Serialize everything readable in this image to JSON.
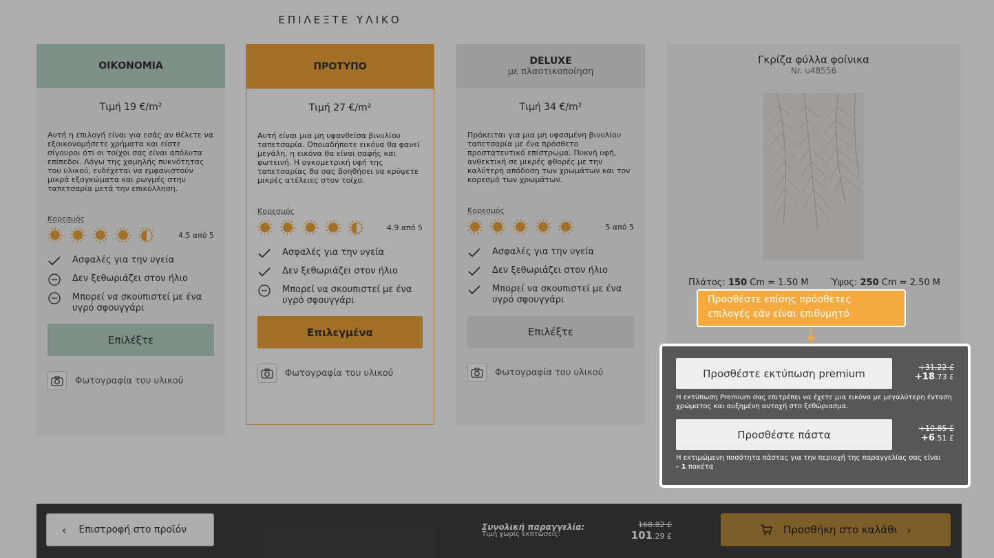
{
  "heading": "ΕΠΙΛΕΞΤΕ ΥΛΙΚΟ",
  "materials": [
    {
      "title": "ΟΙΚΟΝΟΜΙΑ",
      "subtitle": "",
      "price": "Τιμή 19 €/m²",
      "description": "Αυτή η επιλογή είναι για εσάς αν θέλετε να εξοικονομήσετε χρήματα και είστε σίγουροι ότι οι τοίχοι σας είναι απόλυτα επίπεδοι. Λόγω της χαμηλής πυκνότητας του υλικού, ενδέχεται να εμφανιστούν μικρά εξογκώματα και ρωγμές στην ταπετσαρία μετά την επικόλληση.",
      "saturation_label": "Κορεσμός",
      "rating_value": 4.5,
      "rating_text": "4.5 από 5",
      "features": [
        {
          "icon": "check-icon",
          "text": "Ασφαλές για την υγεία"
        },
        {
          "icon": "minus-circle-icon",
          "text": "Δεν ξεθωριάζει στον ήλιο"
        },
        {
          "icon": "minus-circle-icon",
          "text": "Μπορεί να σκουπιστεί με ένα υγρό σφουγγάρι"
        }
      ],
      "button": "Επιλέξτε",
      "photo_label": "Φωτογραφία του υλικού"
    },
    {
      "title": "ΠΡΟΤΥΠΟ",
      "subtitle": "",
      "price": "Τιμή 27 €/m²",
      "description": "Αυτή είναι μια μη υφανθείσα βινυλίου ταπετσαρία. Οποιαδήποτε εικόνα θα φανεί μεγάλη, η εικόνα θα είναι σαφής και φωτεινή. Η ογκομετρική υφή της ταπετσαρίας θα σας βοηθήσει να κρύψετε μικρές ατέλειες στον τοίχο.",
      "saturation_label": "Κορεσμός",
      "rating_value": 4.9,
      "rating_text": "4.9 από 5",
      "features": [
        {
          "icon": "check-icon",
          "text": "Ασφαλές για την υγεία"
        },
        {
          "icon": "check-icon",
          "text": "Δεν ξεθωριάζει στον ήλιο"
        },
        {
          "icon": "minus-circle-icon",
          "text": "Μπορεί να σκουπιστεί με ένα υγρό σφουγγάρι"
        }
      ],
      "button": "Επιλεγμένα",
      "photo_label": "Φωτογραφία του υλικού"
    },
    {
      "title": "DELUXE",
      "subtitle": "με πλαστικοποίηση",
      "price": "Τιμή 34 €/m²",
      "description": "Πρόκειται για μια μη υφασμένη βινυλίου ταπετσαρία με ένα πρόσθετο προστατευτικό επίστρωμα. Πυκνή υφή, ανθεκτική σε μικρές φθορές με την καλύτερη απόδοση των χρωμάτων και τον κορεσμό των χρωμάτων.",
      "saturation_label": "Κορεσμός",
      "rating_value": 5,
      "rating_text": "5 από 5",
      "features": [
        {
          "icon": "check-icon",
          "text": "Ασφαλές για την υγεία"
        },
        {
          "icon": "check-icon",
          "text": "Δεν ξεθωριάζει στον ήλιο"
        },
        {
          "icon": "check-icon",
          "text": "Μπορεί να σκουπιστεί με ένα υγρό σφουγγάρι"
        }
      ],
      "button": "Επιλέξτε",
      "photo_label": "Φωτογραφία του υλικού"
    }
  ],
  "preview": {
    "title": "Γκρίζα φύλλα φοίνικα",
    "number": "Nr. u48556",
    "width_label": "Πλάτος:",
    "width_value": "150",
    "width_unit": "Cm = 1.50 M",
    "height_label": "Ύψος:",
    "height_value": "250",
    "height_unit": "Cm = 2.50 M"
  },
  "tooltip": "Προσθέστε επίσης πρόσθετες επιλογές εάν είναι επιθυμητό",
  "extras": {
    "premium": {
      "button": "Προσθέστε εκτύπωση premium",
      "old_price": "+31.22 £",
      "new_price_main": "+18",
      "new_price_cents": ".73 £",
      "note": "Η εκτύπωση Premium σας επιτρέπει να έχετε μια εικόνα με μεγαλύτερη ένταση χρώματος και αυξημένη αντοχή στο ξεθώριασμα."
    },
    "paste": {
      "button": "Προσθέστε πάστα",
      "old_price": "+10.85 £",
      "new_price_main": "+6",
      "new_price_cents": ".51 £",
      "note_prefix": "Η εκτιμώμενη ποσότητα πάστας για την περιοχή της παραγγελίας σας είναι",
      "note_qty": "- 1",
      "note_suffix": "πακέτα"
    }
  },
  "footer": {
    "back": "Επιστροφή στο προϊόν",
    "total_label": "Συνολική παραγγελία:",
    "total_sublabel": "Τιμή χωρίς εκπτώσεις:",
    "old_total": "168.82 £",
    "new_total_main": "101",
    "new_total_cents": ".29 £",
    "cart": "Προσθήκη στο καλάθι"
  },
  "colors": {
    "accent": "#f0a53a",
    "economy": "#b8d3c6",
    "deluxe": "#e6e6e6",
    "footer": "#3f3f3f",
    "extras_panel": "#575757"
  }
}
